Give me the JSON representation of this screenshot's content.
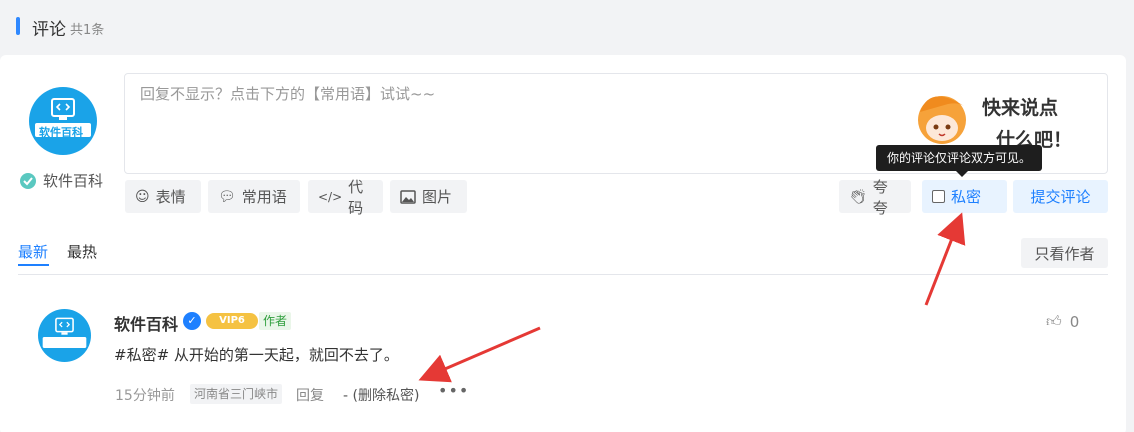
{
  "header": {
    "title": "评论",
    "count": "共1条"
  },
  "composer": {
    "user_name": "软件百科",
    "avatar_text": "软件百科",
    "placeholder": "回复不显示？点击下方的【常用语】试试~~",
    "mascot_text": "快来说点\n什么吧！",
    "tooltip": "你的评论仅评论双方可见。",
    "tools": {
      "emoji": "表情",
      "phrases": "常用语",
      "code": "代码",
      "image": "图片"
    },
    "kuakua": "夸夸",
    "private": "私密",
    "submit": "提交评论"
  },
  "sort_tabs": {
    "newest": "最新",
    "hottest": "最热",
    "only_author": "只看作者"
  },
  "comment": {
    "user_name": "软件百科",
    "vip_label": "VIP6",
    "author_badge": "作者",
    "text": "#私密# 从开始的第一天起，就回不去了。",
    "time": "15分钟前",
    "location": "河南省三门峡市",
    "reply": "回复",
    "delete_private": "- (删除私密)",
    "likes": "0"
  },
  "colors": {
    "accent": "#1e80ff",
    "annotation_arrow": "#e53935"
  },
  "icons": [
    "smile-icon",
    "chat-bubble-icon",
    "code-icon",
    "image-icon",
    "clap-icon",
    "checkbox-icon",
    "verified-icon",
    "thumbs-up-icon",
    "more-icon"
  ]
}
